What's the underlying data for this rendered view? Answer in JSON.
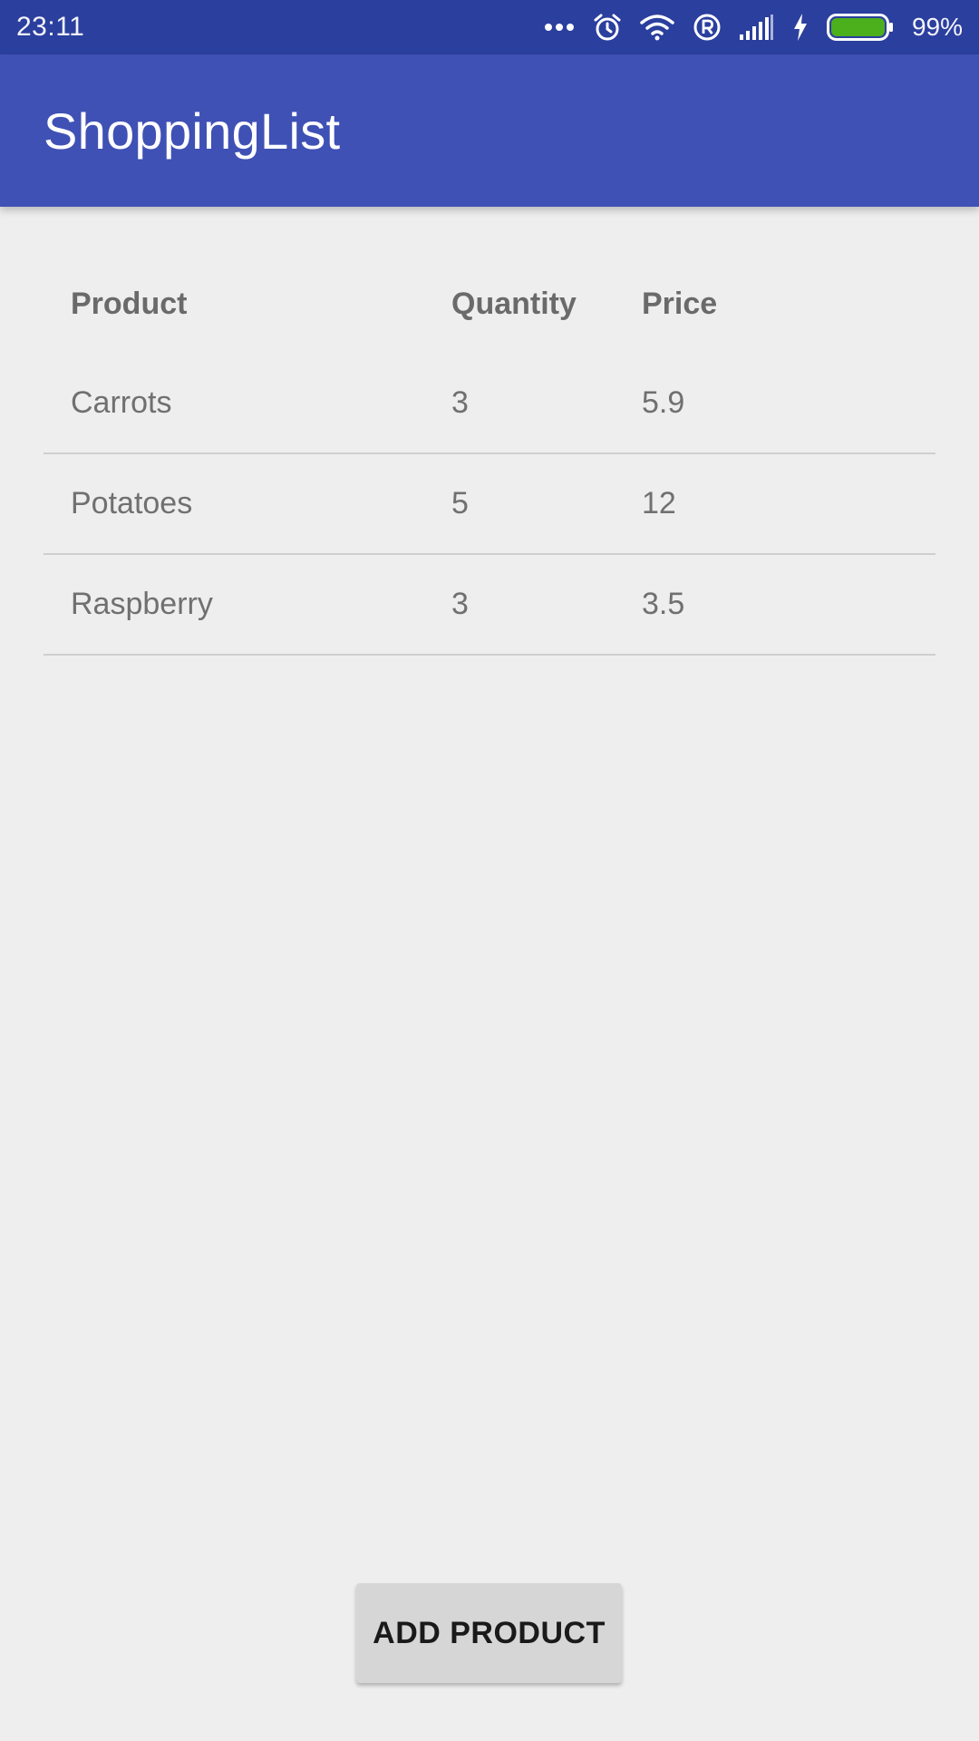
{
  "status_bar": {
    "time": "23:11",
    "battery_percent": "99%",
    "icons": [
      "more-dots-icon",
      "alarm-icon",
      "wifi-icon",
      "registered-icon",
      "signal-icon",
      "charging-icon",
      "battery-icon"
    ],
    "battery_color": "#4caf1c"
  },
  "app_bar": {
    "title": "ShoppingList",
    "color": "#3f51b5"
  },
  "table": {
    "headers": {
      "product": "Product",
      "quantity": "Quantity",
      "price": "Price"
    },
    "rows": [
      {
        "product": "Carrots",
        "quantity": "3",
        "price": "5.9"
      },
      {
        "product": "Potatoes",
        "quantity": "5",
        "price": "12"
      },
      {
        "product": "Raspberry",
        "quantity": "3",
        "price": "3.5"
      }
    ]
  },
  "actions": {
    "add_product_label": "ADD PRODUCT"
  }
}
